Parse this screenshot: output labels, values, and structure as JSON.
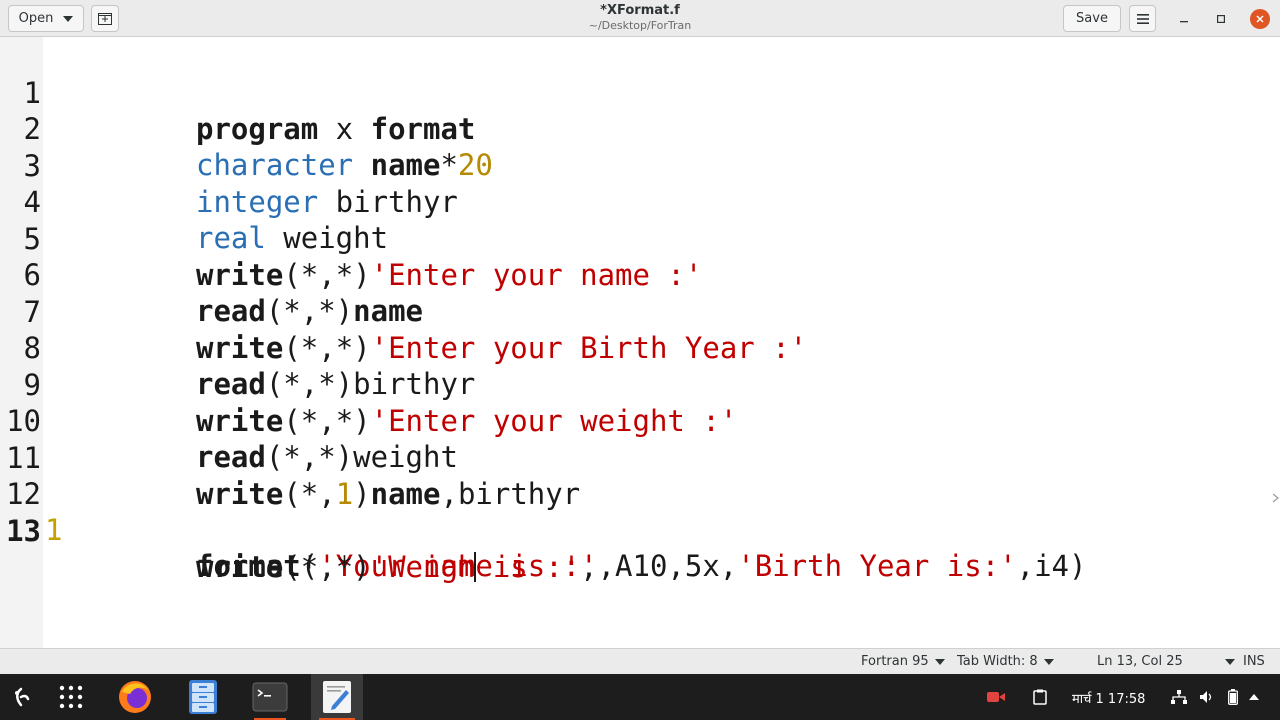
{
  "header": {
    "open_label": "Open",
    "title": "*XFormat.f",
    "subtitle": "~/Desktop/ForTran",
    "save_label": "Save"
  },
  "editor": {
    "line_numbers": [
      "1",
      "2",
      "3",
      "4",
      "5",
      "6",
      "7",
      "8",
      "9",
      "10",
      "11",
      "12",
      "13"
    ],
    "line12_marker": "1",
    "current_line": 13,
    "lines": {
      "l1": {
        "a": "program",
        "b": " x ",
        "c": "format"
      },
      "l2": {
        "a": "character",
        "b": " ",
        "c": "name",
        "d": "*",
        "e": "20"
      },
      "l3": {
        "a": "integer",
        "b": " birthyr"
      },
      "l4": {
        "a": "real",
        "b": " weight"
      },
      "l5": {
        "a": "write",
        "b": "(*,*)",
        "c": "'Enter your name :'"
      },
      "l6": {
        "a": "read",
        "b": "(*,*)",
        "c": "name"
      },
      "l7": {
        "a": "write",
        "b": "(*,*)",
        "c": "'Enter your Birth Year :'"
      },
      "l8": {
        "a": "read",
        "b": "(*,*)birthyr"
      },
      "l9": {
        "a": "write",
        "b": "(*,*)",
        "c": "'Enter your weight :'"
      },
      "l10": {
        "a": "read",
        "b": "(*,*)weight"
      },
      "l11": {
        "a": "write",
        "b": "(*,",
        "c": "1",
        "d": ")",
        "e": "name",
        "f": ",birthyr"
      },
      "l12": {
        "a": "format",
        "b": "(",
        "c": "'Your name is :'",
        "d": ",A10,5x,",
        "e": "'Birth Year is:'",
        "f": ",i4)"
      },
      "l13": {
        "a": "write",
        "b": "(*,*)",
        "c1": "'Weigh",
        "c2": " is :'",
        "d": ","
      }
    }
  },
  "statusbar": {
    "language": "Fortran 95",
    "tab_width": "Tab Width: 8",
    "position": "Ln 13, Col 25",
    "mode": "INS"
  },
  "taskbar": {
    "clock": "मार्च 1  17:58"
  },
  "colors": {
    "keyword_type": "#2a6fb3",
    "string": "#c00000",
    "number": "#b58900",
    "close_button": "#e05524",
    "active_underline": "#e95420"
  }
}
